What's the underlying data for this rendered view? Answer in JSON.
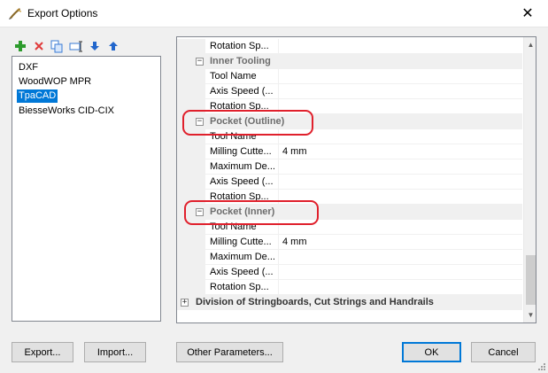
{
  "window": {
    "title": "Export Options",
    "icon": "app-pen-icon",
    "close_glyph": "✕"
  },
  "toolbar": {
    "buttons": [
      {
        "name": "add",
        "icon": "plus-icon",
        "color": "#2d9b2d"
      },
      {
        "name": "delete",
        "icon": "delete-x-icon",
        "color": "#e03a3a"
      },
      {
        "name": "copy",
        "icon": "copy-icon",
        "color": "#3a7bd5"
      },
      {
        "name": "rename",
        "icon": "rename-icon",
        "color": "#3a7bd5"
      },
      {
        "name": "move-down",
        "icon": "arrow-down-icon",
        "color": "#2266cc"
      },
      {
        "name": "move-up",
        "icon": "arrow-up-icon",
        "color": "#2266cc"
      }
    ]
  },
  "formats": {
    "items": [
      "DXF",
      "WoodWOP MPR",
      "TpaCAD",
      "BiesseWorks CID-CIX"
    ],
    "selected": "TpaCAD"
  },
  "grid": {
    "rows": [
      {
        "kind": "prop",
        "name": "Rotation Sp...",
        "value": ""
      },
      {
        "kind": "cat",
        "label": "Inner Tooling",
        "toggle": "⊟"
      },
      {
        "kind": "prop",
        "name": "Tool Name",
        "value": ""
      },
      {
        "kind": "prop",
        "name": "Axis Speed (...",
        "value": ""
      },
      {
        "kind": "prop",
        "name": "Rotation Sp...",
        "value": ""
      },
      {
        "kind": "cat",
        "label": "Pocket (Outline)",
        "toggle": "⊟"
      },
      {
        "kind": "prop",
        "name": "Tool Name",
        "value": ""
      },
      {
        "kind": "prop",
        "name": "Milling Cutte...",
        "value": "4 mm"
      },
      {
        "kind": "prop",
        "name": "Maximum De...",
        "value": ""
      },
      {
        "kind": "prop",
        "name": "Axis Speed (...",
        "value": ""
      },
      {
        "kind": "prop",
        "name": "Rotation Sp...",
        "value": ""
      },
      {
        "kind": "cat",
        "label": "Pocket (Inner)",
        "toggle": "⊟"
      },
      {
        "kind": "prop",
        "name": "Tool Name",
        "value": ""
      },
      {
        "kind": "prop",
        "name": "Milling Cutte...",
        "value": "4 mm"
      },
      {
        "kind": "prop",
        "name": "Maximum De...",
        "value": ""
      },
      {
        "kind": "prop",
        "name": "Axis Speed (...",
        "value": ""
      },
      {
        "kind": "prop",
        "name": "Rotation Sp...",
        "value": ""
      },
      {
        "kind": "maincat",
        "label": "Division of Stringboards, Cut Strings and Handrails",
        "toggle": "⊞"
      }
    ],
    "scroll_position": 0.85
  },
  "buttons": {
    "export": "Export...",
    "import": "Import...",
    "other_parameters": "Other Parameters...",
    "ok": "OK",
    "cancel": "Cancel"
  },
  "colors": {
    "selection": "#0078d7",
    "annotation": "#e0202c"
  }
}
